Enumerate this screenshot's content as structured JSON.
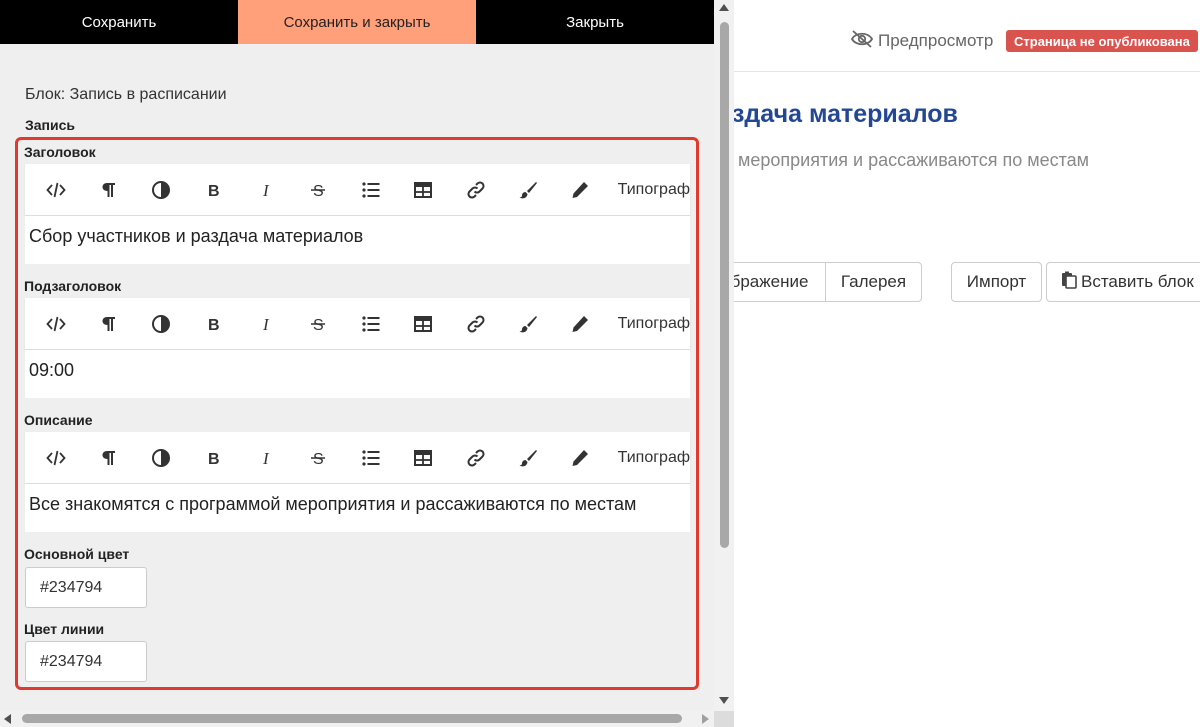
{
  "background_page": {
    "preview_label": "Предпросмотр",
    "status_badge": "Страница не опубликована",
    "title_fragment": "здача материалов",
    "subtitle_fragment": "мероприятия и рассаживаются по местам",
    "buttons": {
      "image": "бражение",
      "gallery": "Галерея",
      "import": "Импорт",
      "insert_block": "Вставить блок"
    }
  },
  "actions": {
    "save": "Сохранить",
    "save_close": "Сохранить и закрыть",
    "close": "Закрыть"
  },
  "block_label": "Блок: Запись в расписании",
  "section_label": "Запись",
  "toolbar": {
    "typograph": "Типограф",
    "icons": [
      "code-icon",
      "paragraph-icon",
      "contrast-icon",
      "bold-icon",
      "italic-icon",
      "strikethrough-icon",
      "list-icon",
      "table-icon",
      "link-icon",
      "brush-icon",
      "pencil-icon"
    ]
  },
  "fields": {
    "heading": {
      "label": "Заголовок",
      "value": "Сбор участников и раздача материалов"
    },
    "subheading": {
      "label": "Подзаголовок",
      "value": "09:00"
    },
    "description": {
      "label": "Описание",
      "value": "Все знакомятся с программой мероприятия и рассаживаются по местам"
    },
    "main_color": {
      "label": "Основной цвет",
      "value": "#234794"
    },
    "line_color": {
      "label": "Цвет линии",
      "value": "#234794"
    }
  },
  "colors": {
    "accent_title": "#234794",
    "save_close_bg": "#ffa07a",
    "badge_bg": "#d9534f",
    "highlight_border": "#e03a2f"
  }
}
